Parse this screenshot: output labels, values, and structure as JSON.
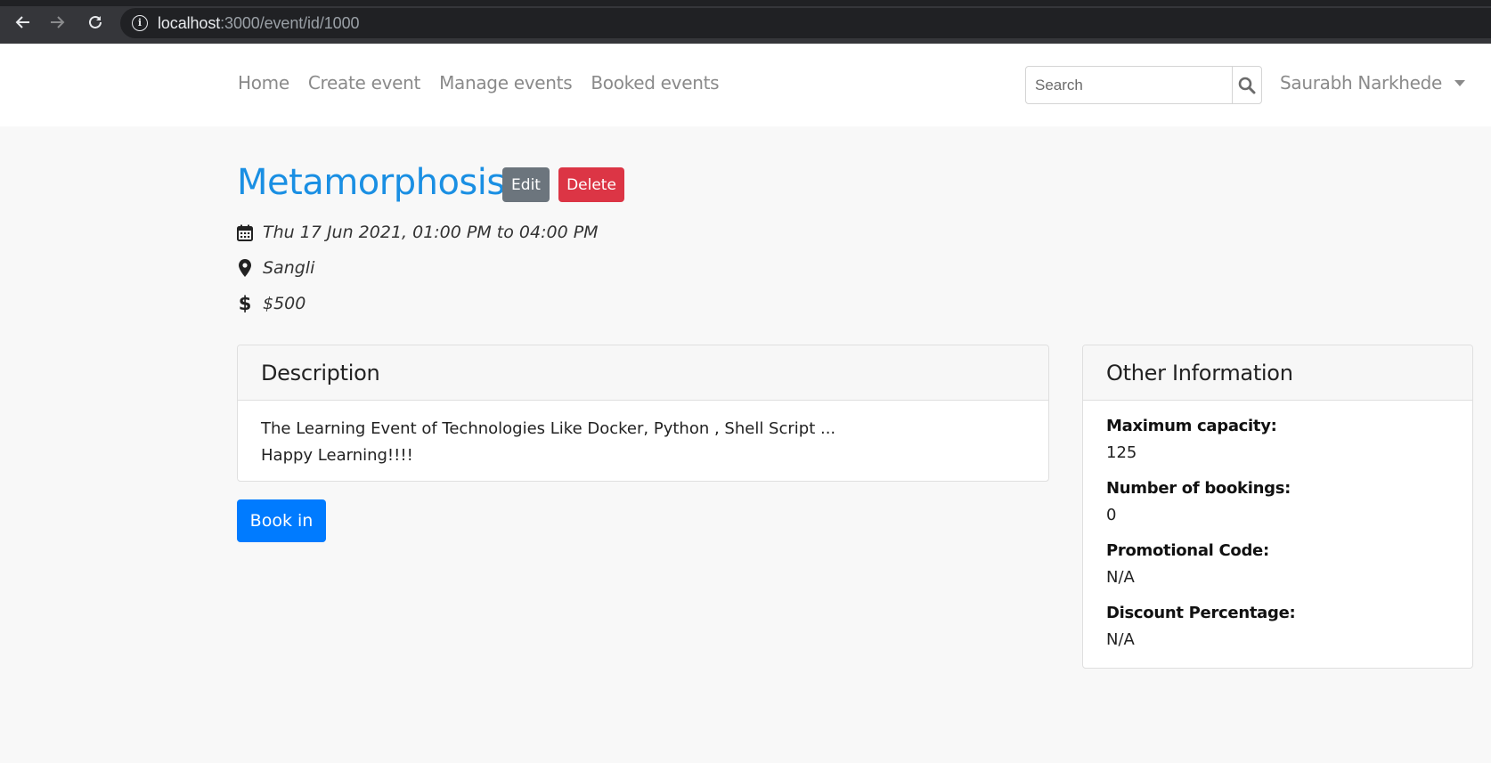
{
  "browser": {
    "url_host": "localhost",
    "url_path": ":3000/event/id/1000",
    "back_icon": "arrow-left-icon",
    "forward_icon": "arrow-right-icon",
    "reload_icon": "reload-icon",
    "info_icon": "info-icon"
  },
  "navbar": {
    "links": [
      "Home",
      "Create event",
      "Manage events",
      "Booked events"
    ],
    "search_placeholder": "Search",
    "search_icon": "search-icon",
    "user_name": "Saurabh Narkhede"
  },
  "event": {
    "title": "Metamorphosis",
    "edit_label": "Edit",
    "delete_label": "Delete",
    "datetime": "Thu 17 Jun 2021, 01:00 PM to 04:00 PM",
    "location": "Sangli",
    "price": "$500",
    "book_label": "Book in"
  },
  "description": {
    "heading": "Description",
    "lines": [
      "The Learning Event of Technologies Like Docker, Python , Shell Script ...",
      "Happy Learning!!!!"
    ]
  },
  "other_info": {
    "heading": "Other Information",
    "items": [
      {
        "label": "Maximum capacity:",
        "value": "125"
      },
      {
        "label": "Number of bookings:",
        "value": "0"
      },
      {
        "label": "Promotional Code:",
        "value": "N/A"
      },
      {
        "label": "Discount Percentage:",
        "value": "N/A"
      }
    ]
  },
  "colors": {
    "title": "#1a8fe3",
    "edit": "#6c757d",
    "delete": "#dc3545",
    "book": "#007bff"
  }
}
